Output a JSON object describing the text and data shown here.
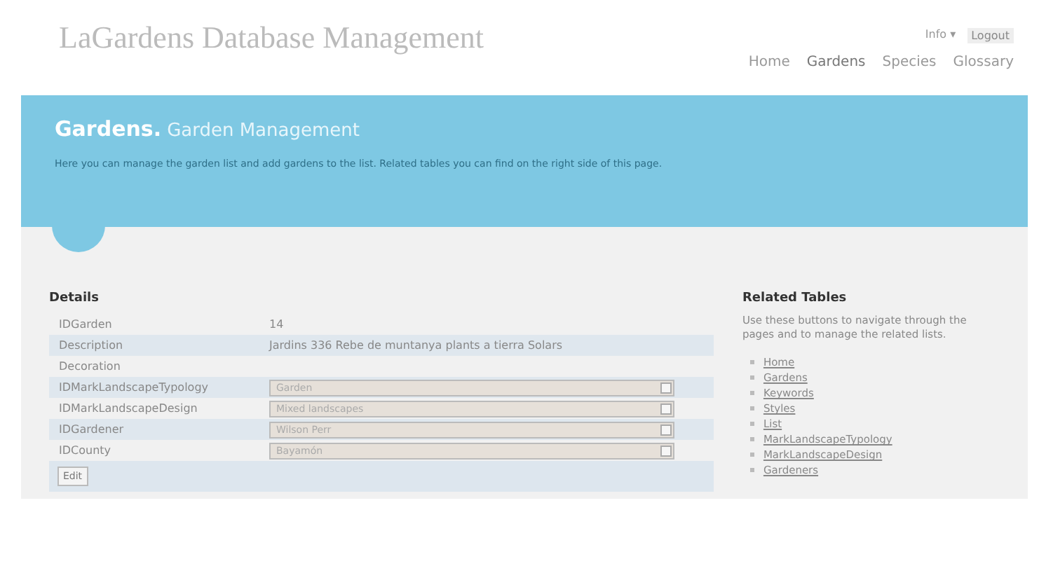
{
  "header": {
    "title": "LaGardens Database Management",
    "user_links": [
      "Info ▾",
      "Logout"
    ],
    "nav": [
      {
        "label": "Home",
        "selected": false
      },
      {
        "label": "Gardens",
        "selected": true
      },
      {
        "label": "Species",
        "selected": false
      },
      {
        "label": "Glossary",
        "selected": false
      }
    ]
  },
  "banner": {
    "title": "Gardens.",
    "subtitle": "Garden Management",
    "text": "Here you can manage the garden list and add gardens to the list. Related tables you can find on the right side of this page."
  },
  "details": {
    "heading": "Details",
    "rows": [
      {
        "kind": "text",
        "label": "IDGarden",
        "value": "14"
      },
      {
        "kind": "text",
        "label": "Description",
        "value": "Jardins 336 Rebe de muntanya plants a tierra Solars"
      },
      {
        "kind": "text",
        "label": "Decoration"
      },
      {
        "kind": "select",
        "label": "IDMarkLandscapeTypology",
        "value": "Garden"
      },
      {
        "kind": "select",
        "label": "IDMarkLandscapeDesign",
        "value": "Mixed landscapes"
      },
      {
        "kind": "select",
        "label": "IDGardener",
        "value": "Wilson Perr"
      },
      {
        "kind": "select",
        "label": "IDCounty",
        "value": "Bayamón"
      }
    ],
    "button": "Edit"
  },
  "related": {
    "heading": "Related Tables",
    "text": "Use these buttons to navigate through the pages and to manage the related lists.",
    "links": [
      "Home",
      "Gardens",
      "Keywords",
      "Styles",
      "List",
      "MarkLandscapeTypology",
      "MarkLandscapeDesign",
      "Gardeners"
    ]
  }
}
